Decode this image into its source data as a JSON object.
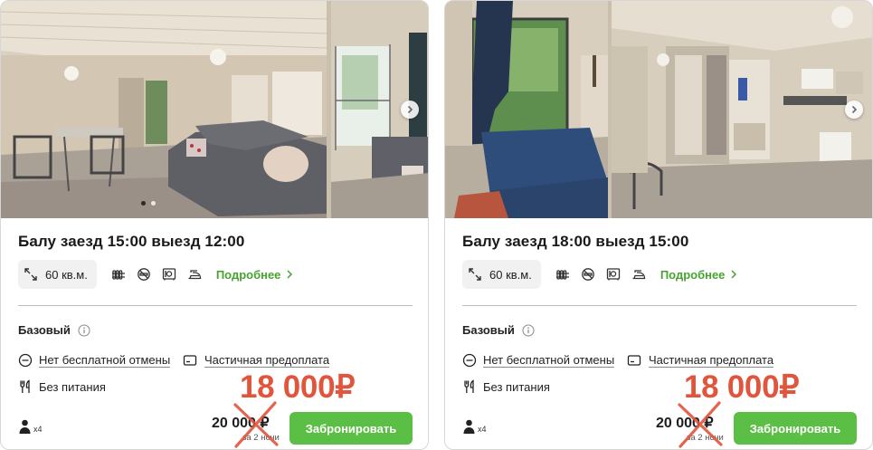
{
  "colors": {
    "accent_green": "#5cbf45",
    "link_green": "#47a32f",
    "price_red": "#e0553c"
  },
  "icons": {
    "area": "expand-arrows-icon",
    "radiator": "radiator-icon",
    "no_smoking": "no-smoking-icon",
    "safe": "safe-icon",
    "iron": "iron-icon",
    "more": "chevron-right-icon",
    "info": "info-icon",
    "cancel": "minus-circle-icon",
    "prepayment": "card-icon",
    "meals": "fork-knife-icon",
    "guests": "person-icon",
    "gallery_next": "chevron-right-icon"
  },
  "cards": [
    {
      "title": "Балу заезд 15:00 выезд 12:00",
      "area": "60 кв.м.",
      "more_label": "Подробнее",
      "tariff": "Базовый",
      "cancellation": "Нет бесплатной отмены",
      "prepayment": "Частичная предоплата",
      "meals": "Без питания",
      "new_price": "18 000₽",
      "old_price": "20 000 ₽",
      "nights": "за 2 ночи",
      "guests": "x4",
      "book_label": "Забронировать"
    },
    {
      "title": "Балу заезд 18:00 выезд 15:00",
      "area": "60 кв.м.",
      "more_label": "Подробнее",
      "tariff": "Базовый",
      "cancellation": "Нет бесплатной отмены",
      "prepayment": "Частичная предоплата",
      "meals": "Без питания",
      "new_price": "18 000₽",
      "old_price": "20 000 ₽",
      "nights": "за 2 ночи",
      "guests": "x4",
      "book_label": "Забронировать"
    }
  ]
}
